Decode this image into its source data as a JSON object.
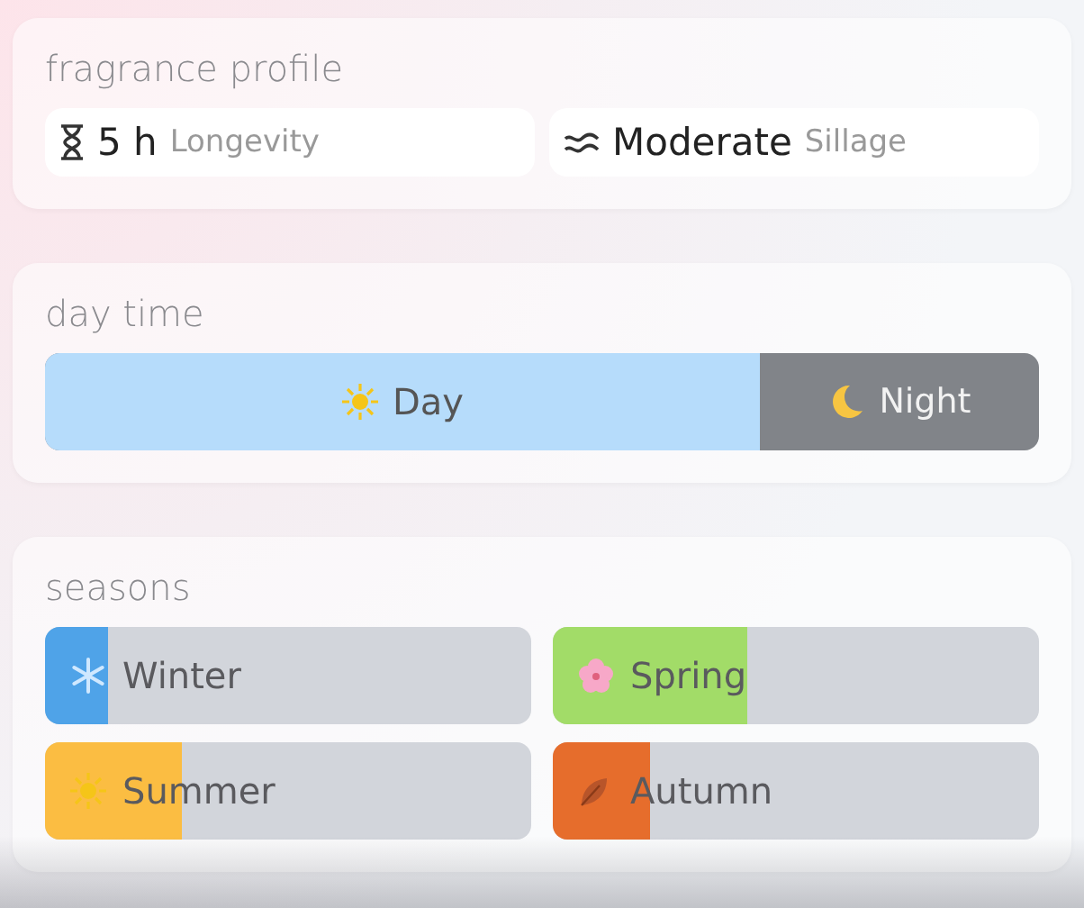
{
  "fragrance_profile": {
    "title": "fragrance profile",
    "stats": [
      {
        "kind": "hourglass",
        "value": "5 h",
        "label": "Longevity"
      },
      {
        "kind": "waves",
        "value": "Moderate",
        "label": "Sillage"
      }
    ]
  },
  "day_time": {
    "title": "day time",
    "day": {
      "label": "Day",
      "level": 0.72
    },
    "night": {
      "label": "Night"
    }
  },
  "seasons": {
    "title": "seasons",
    "items": [
      {
        "kind": "winter",
        "label": "Winter",
        "level": 0.13,
        "color": "#4fa3e8"
      },
      {
        "kind": "spring",
        "label": "Spring",
        "level": 0.4,
        "color": "#a2dc68"
      },
      {
        "kind": "summer",
        "label": "Summer",
        "level": 0.28,
        "color": "#fbbd42"
      },
      {
        "kind": "autumn",
        "label": "Autumn",
        "level": 0.2,
        "color": "#e66d2c"
      }
    ]
  }
}
